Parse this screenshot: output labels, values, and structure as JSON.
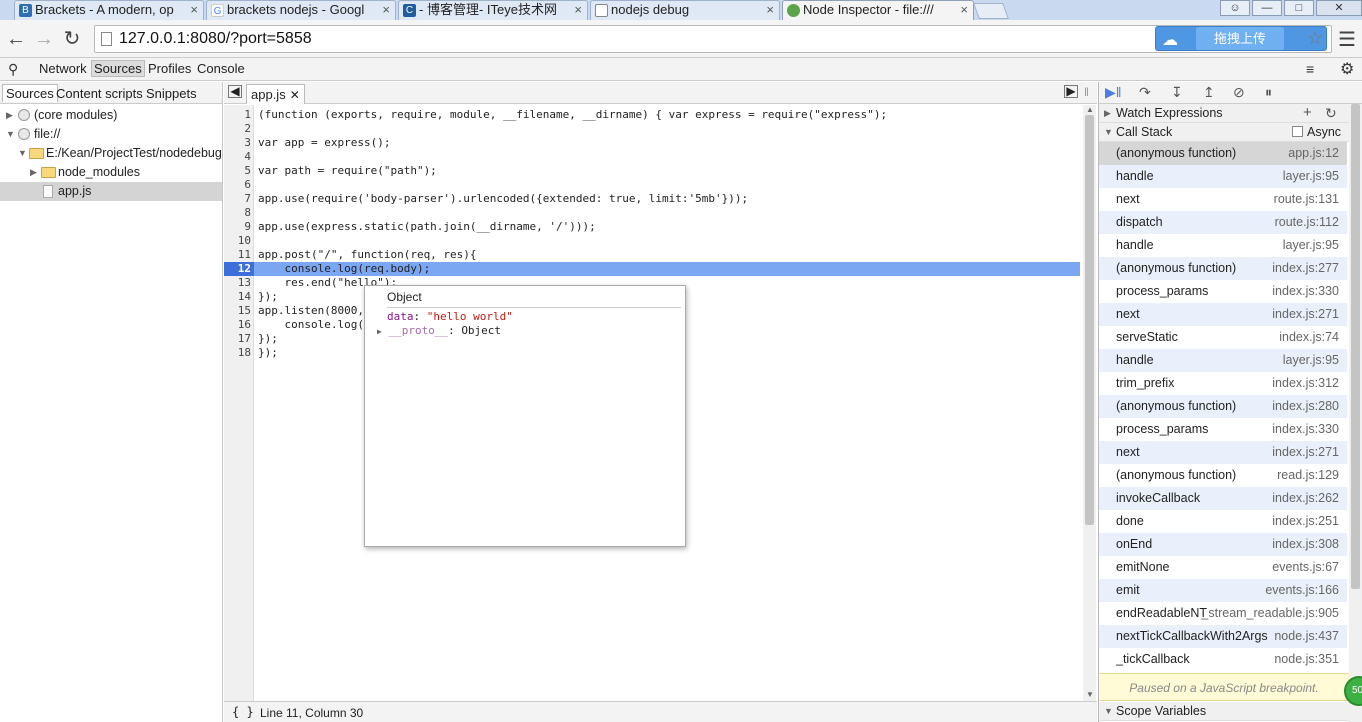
{
  "browser": {
    "tabs": [
      {
        "title": "Brackets - A modern, op",
        "icon": "brackets-icon",
        "color": "#2e6fb4"
      },
      {
        "title": "brackets nodejs - Googl",
        "icon": "google-icon",
        "color": "#4285f4"
      },
      {
        "title": "- 博客管理- ITeye技术网",
        "icon": "iteye-icon",
        "color": "#1f5d9e"
      },
      {
        "title": "nodejs debug",
        "icon": "page-icon",
        "color": "#888888"
      },
      {
        "title": "Node Inspector - file:///",
        "icon": "node-inspector-icon",
        "color": "#5aa54a"
      }
    ],
    "url": "127.0.0.1:8080/?port=5858",
    "upload_label": "拖拽上传"
  },
  "devtools": {
    "panels": [
      "Network",
      "Sources",
      "Profiles",
      "Console"
    ],
    "selected_panel": "Sources"
  },
  "navigator": {
    "tabs": [
      "Sources",
      "Content scripts",
      "Snippets"
    ],
    "tree": [
      {
        "label": "(core modules)",
        "depth": 0,
        "kind": "globe",
        "expanded": false
      },
      {
        "label": "file://",
        "depth": 0,
        "kind": "globe",
        "expanded": true
      },
      {
        "label": "E:/Kean/ProjectTest/nodedebug",
        "depth": 1,
        "kind": "folder",
        "expanded": true
      },
      {
        "label": "node_modules",
        "depth": 2,
        "kind": "folder",
        "expanded": false
      },
      {
        "label": "app.js",
        "depth": 2,
        "kind": "file",
        "selected": true
      }
    ]
  },
  "editor": {
    "tab": "app.js",
    "current_line": 12,
    "status": "Line 11, Column 30",
    "braces": "{ }",
    "lines": [
      "(function (exports, require, module, __filename, __dirname) { var express = require(\"express\");",
      "",
      "var app = express();",
      "",
      "var path = require(\"path\");",
      "",
      "app.use(require('body-parser').urlencoded({extended: true, limit:'5mb'}));",
      "",
      "app.use(express.static(path.join(__dirname, '/')));",
      "",
      "app.post(\"/\", function(req, res){",
      "    console.log(req.body);",
      "    res.end(\"hello\");",
      "});",
      "app.listen(8000,",
      "    console.log(",
      "});",
      "});"
    ]
  },
  "popover": {
    "title": "Object",
    "prop1_key": "data",
    "prop1_value": "\"hello world\"",
    "prop2_key": "__proto__",
    "prop2_value": "Object"
  },
  "sidebar": {
    "watch_label": "Watch Expressions",
    "callstack_label": "Call Stack",
    "async_label": "Async",
    "frames": [
      {
        "fn": "(anonymous function)",
        "loc": "app.js:12"
      },
      {
        "fn": "handle",
        "loc": "layer.js:95"
      },
      {
        "fn": "next",
        "loc": "route.js:131"
      },
      {
        "fn": "dispatch",
        "loc": "route.js:112"
      },
      {
        "fn": "handle",
        "loc": "layer.js:95"
      },
      {
        "fn": "(anonymous function)",
        "loc": "index.js:277"
      },
      {
        "fn": "process_params",
        "loc": "index.js:330"
      },
      {
        "fn": "next",
        "loc": "index.js:271"
      },
      {
        "fn": "serveStatic",
        "loc": "index.js:74"
      },
      {
        "fn": "handle",
        "loc": "layer.js:95"
      },
      {
        "fn": "trim_prefix",
        "loc": "index.js:312"
      },
      {
        "fn": "(anonymous function)",
        "loc": "index.js:280"
      },
      {
        "fn": "process_params",
        "loc": "index.js:330"
      },
      {
        "fn": "next",
        "loc": "index.js:271"
      },
      {
        "fn": "(anonymous function)",
        "loc": "read.js:129"
      },
      {
        "fn": "invokeCallback",
        "loc": "index.js:262"
      },
      {
        "fn": "done",
        "loc": "index.js:251"
      },
      {
        "fn": "onEnd",
        "loc": "index.js:308"
      },
      {
        "fn": "emitNone",
        "loc": "events.js:67"
      },
      {
        "fn": "emit",
        "loc": "events.js:166"
      },
      {
        "fn": "endReadableNT",
        "loc": "_stream_readable.js:905"
      },
      {
        "fn": "nextTickCallbackWith2Args",
        "loc": "node.js:437"
      },
      {
        "fn": "_tickCallback",
        "loc": "node.js:351"
      }
    ],
    "paused_message": "Paused on a JavaScript breakpoint.",
    "scope_label": "Scope Variables"
  },
  "badge": "50"
}
